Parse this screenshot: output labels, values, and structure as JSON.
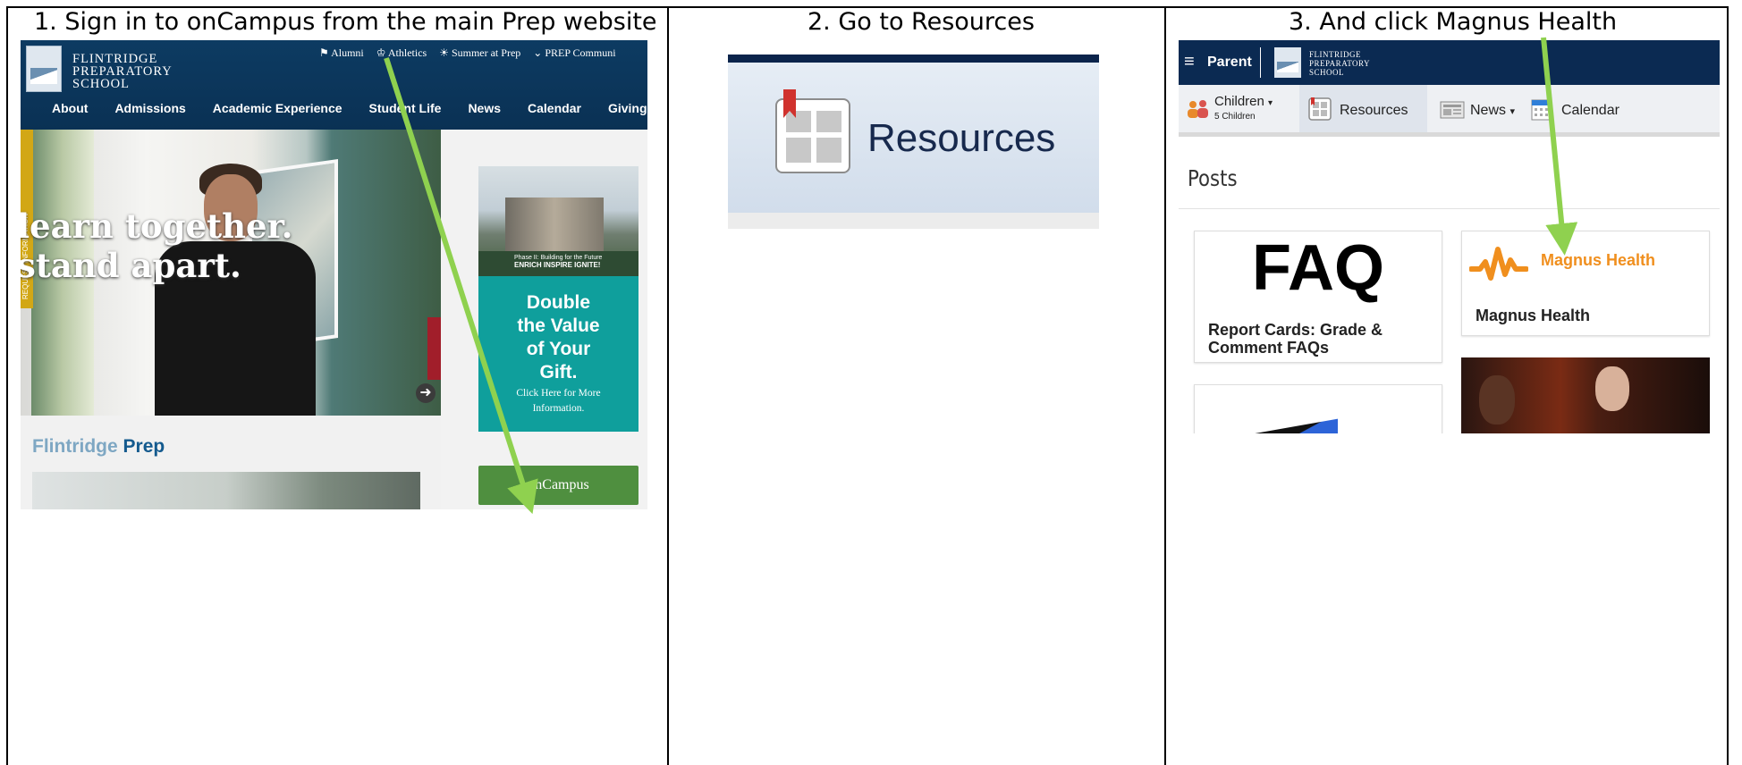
{
  "captions": {
    "step1": "1.  Sign in to onCampus from the main Prep website",
    "step2": "2. Go to Resources",
    "step3": "3. And click Magnus Health"
  },
  "prep_site": {
    "logo_lines": [
      "FLINTRIDGE",
      "PREPARATORY",
      "SCHOOL"
    ],
    "top_links": [
      "⚑ Alumni",
      "♔ Athletics",
      "☀ Summer at Prep",
      "⌄ PREP Communi"
    ],
    "main_nav": [
      "About",
      "Admissions",
      "Academic Experience",
      "Student Life",
      "News",
      "Calendar",
      "Giving"
    ],
    "hero_text": "learn together.\nstand apart.",
    "side_tab": "REQUEST INFORMATION",
    "ad_strip_line1": "Phase II: Building for the Future",
    "ad_strip_line2": "ENRICH INSPIRE IGNITE!",
    "ad_title": "Double\nthe Value\nof Your\nGift.",
    "ad_subtitle": "Click Here for More\nInformation.",
    "oncampus_button": "onCampus",
    "section_title_a": "Flintridge",
    "section_title_b": "Prep"
  },
  "resources_zoom": {
    "label": "Resources"
  },
  "oncampus_portal": {
    "role": "Parent",
    "logo_lines": [
      "FLINTRIDGE",
      "PREPARATORY",
      "SCHOOL"
    ],
    "nav": {
      "children": "Children",
      "children_count": "5 Children",
      "resources": "Resources",
      "news": "News",
      "calendar": "Calendar"
    },
    "posts_heading": "Posts",
    "cards": {
      "faq_big": "FAQ",
      "faq_title": "Report Cards: Grade &\nComment FAQs",
      "magnus_logo": "Magnus Health",
      "magnus_title": "Magnus Health"
    }
  },
  "colors": {
    "arrow": "#8fd14f",
    "navy": "#0b2a52",
    "teal": "#0f9f9c",
    "oncampus_green": "#4f8f3f",
    "magnus_orange": "#f08f1e"
  }
}
